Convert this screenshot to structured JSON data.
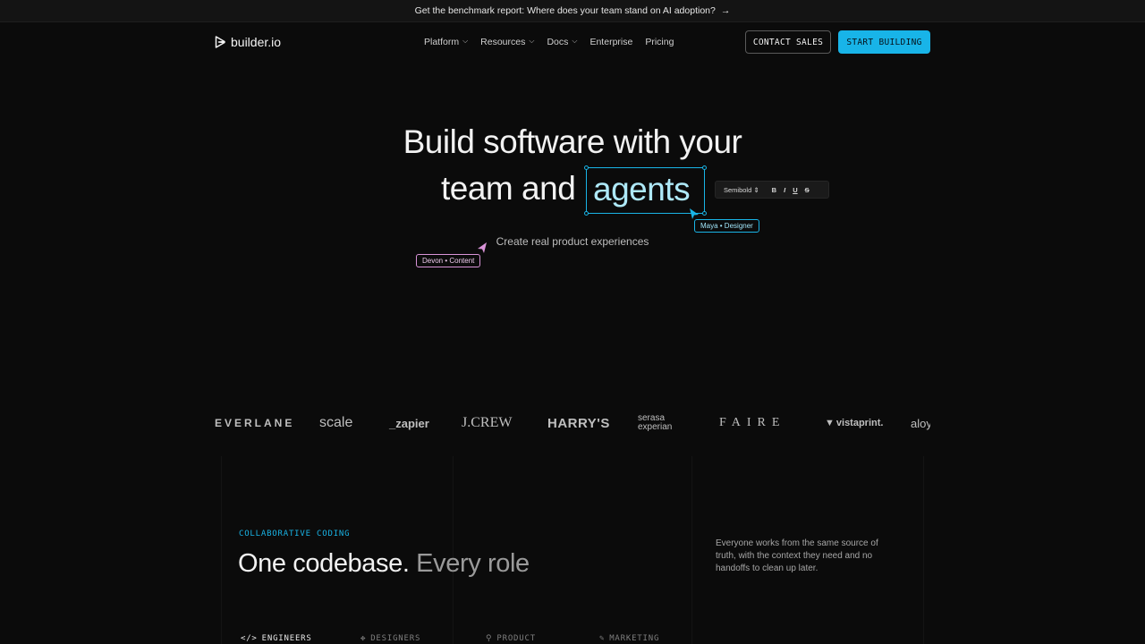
{
  "banner": {
    "text": "Get the benchmark report: Where does your team stand on AI adoption?",
    "arrow": "→"
  },
  "nav": {
    "logo_text": "builder.io",
    "menu": [
      {
        "label": "Platform",
        "has_dropdown": true
      },
      {
        "label": "Resources",
        "has_dropdown": true
      },
      {
        "label": "Docs",
        "has_dropdown": true
      },
      {
        "label": "Enterprise",
        "has_dropdown": false
      },
      {
        "label": "Pricing",
        "has_dropdown": false
      }
    ],
    "contact_label": "CONTACT SALES",
    "start_label": "START BUILDING"
  },
  "hero": {
    "line1": "Build software with your",
    "line2_prefix": "team and",
    "highlight": "agents",
    "subtitle": "Create real product experiences",
    "toolbar": {
      "font_weight": "Semibold",
      "bold": "B",
      "italic": "I",
      "underline": "U",
      "strike": "S"
    },
    "cursor_tag_maya": "Maya • Designer",
    "cursor_tag_devon": "Devon • Content"
  },
  "logos": {
    "everlane": "EVERLANE",
    "scale": "scale",
    "zapier": "_zapier",
    "jcrew": "J.CREW",
    "harrys": "HARRY'S",
    "serasa_1": "serasa",
    "serasa_2": "experian",
    "faire": "FAIRE",
    "vistaprint": "vistaprint.",
    "aloy": "aloy"
  },
  "section": {
    "eyebrow": "COLLABORATIVE CODING",
    "title_a": "One codebase.",
    "title_b": "Every role",
    "description": "Everyone works from the same source of truth, with the context they need and no handoffs to clean up later.",
    "tabs": [
      {
        "label": "ENGINEERS",
        "icon": "</>"
      },
      {
        "label": "DESIGNERS",
        "icon": "✥"
      },
      {
        "label": "PRODUCT",
        "icon": "⚲"
      },
      {
        "label": "MARKETING",
        "icon": "✎"
      }
    ]
  },
  "colors": {
    "accent": "#18b4e8",
    "cursor_pink": "#d994d8",
    "background": "#0b0b0b"
  }
}
